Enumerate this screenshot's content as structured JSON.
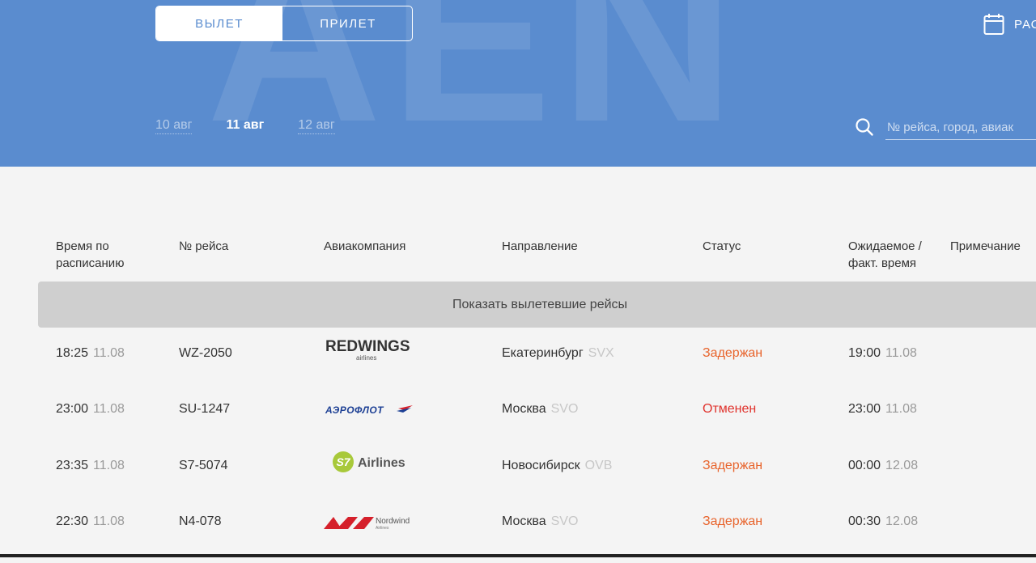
{
  "header": {
    "watermark": "AEN",
    "tabs": [
      {
        "label": "ВЫЛЕТ",
        "active": true
      },
      {
        "label": "ПРИЛЕТ",
        "active": false
      }
    ],
    "schedule_label": "РАС",
    "dates": [
      {
        "label": "10 авг",
        "active": false
      },
      {
        "label": "11 авг",
        "active": true
      },
      {
        "label": "12 авг",
        "active": false
      }
    ],
    "search_placeholder": "№ рейса, город, авиак"
  },
  "table": {
    "columns": [
      "Время по расписанию",
      "№ рейса",
      "Авиакомпания",
      "Направление",
      "Статус",
      "Ожидаемое / факт. время",
      "Примечание"
    ],
    "show_departed_label": "Показать вылетевшие рейсы",
    "rows": [
      {
        "time": "18:25",
        "date": "11.08",
        "flight": "WZ-2050",
        "airline": "REDWINGS",
        "airline_sub": "airlines",
        "city": "Екатеринбург",
        "iata": "SVX",
        "status": "Задержан",
        "status_color": "#e8642c",
        "exp_time": "19:00",
        "exp_date": "11.08"
      },
      {
        "time": "23:00",
        "date": "11.08",
        "flight": "SU-1247",
        "airline": "АЭРОФЛОТ",
        "airline_sub": "",
        "city": "Москва",
        "iata": "SVO",
        "status": "Отменен",
        "status_color": "#e0322c",
        "exp_time": "23:00",
        "exp_date": "11.08"
      },
      {
        "time": "23:35",
        "date": "11.08",
        "flight": "S7-5074",
        "airline": "Airlines",
        "airline_sub": "S7",
        "city": "Новосибирск",
        "iata": "OVB",
        "status": "Задержан",
        "status_color": "#e8642c",
        "exp_time": "00:00",
        "exp_date": "12.08"
      },
      {
        "time": "22:30",
        "date": "11.08",
        "flight": "N4-078",
        "airline": "Nordwind",
        "airline_sub": "Airlines",
        "city": "Москва",
        "iata": "SVO",
        "status": "Задержан",
        "status_color": "#e8642c",
        "exp_time": "00:30",
        "exp_date": "12.08"
      }
    ]
  },
  "colors": {
    "header_bg": "#5a8ccf",
    "delayed": "#e8642c",
    "cancelled": "#e0322c",
    "redwings_red": "#d5202b",
    "s7_green": "#a8c93a",
    "aeroflot_blue": "#1c3f94"
  }
}
